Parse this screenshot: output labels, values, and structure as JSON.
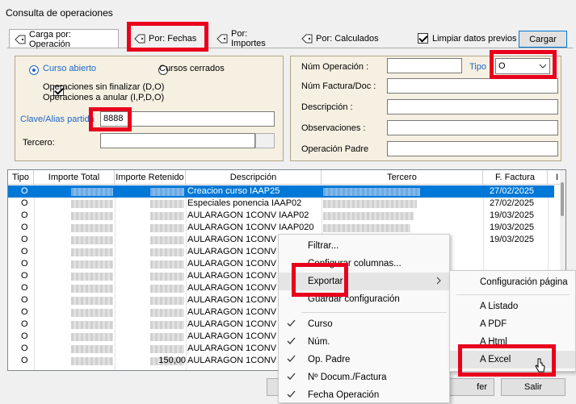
{
  "window": {
    "title": "Consulta de operaciones"
  },
  "tabs": [
    {
      "label": "Carga por: Operación",
      "icon": "tag-icon"
    },
    {
      "label": "Por: Fechas",
      "icon": "tag-icon"
    },
    {
      "label": "Por: Importes",
      "icon": "tag-icon"
    },
    {
      "label": "Por: Calculados",
      "icon": "tag-icon"
    }
  ],
  "toolbar": {
    "clear_label": "Limpiar datos previos",
    "clear_checked": true,
    "load_label": "Cargar"
  },
  "left_panel": {
    "radio_open": "Curso abierto",
    "radio_closed": "Cursos cerrados",
    "chk_line1": "Operaciones sin finalizar (D,O)",
    "chk_line2": "Operaciones a anular (I,P,D,O)",
    "key_label": "Clave/Alias partida",
    "key_value": "8888",
    "third_label": "Tercero:",
    "third_value": ""
  },
  "right_panel": {
    "num_op_label": "Núm Operación :",
    "num_op_value": "",
    "tipo_label": "Tipo",
    "tipo_value": "O",
    "num_fact_label": "Núm Factura/Doc :",
    "desc_label": "Descripción :",
    "obs_label": "Observaciones :",
    "parent_label": "Operación Padre"
  },
  "grid": {
    "headers": [
      "Tipo",
      "Importe Total",
      "Importe Retenido",
      "Descripción",
      "Tercero",
      "F. Factura",
      "I"
    ],
    "rows": [
      {
        "tipo": "O",
        "desc": "Creacion curso IAAP25",
        "fecha": "27/02/2025"
      },
      {
        "tipo": "O",
        "desc": "Especiales ponencia IAAP02",
        "fecha": "27/02/2025"
      },
      {
        "tipo": "O",
        "desc": "AULARAGON 1CONV IAAP02",
        "fecha": "19/03/2025"
      },
      {
        "tipo": "O",
        "desc": "AULARAGON 1CONV IAAP020",
        "fecha": "19/03/2025"
      },
      {
        "tipo": "O",
        "desc": "AULARAGON 1CONV",
        "fecha": "19/03/2025"
      },
      {
        "tipo": "O",
        "desc": "AULARAGON 1CONV",
        "fecha": ""
      },
      {
        "tipo": "O",
        "desc": "AULARAGON 1CONV",
        "fecha": ""
      },
      {
        "tipo": "O",
        "desc": "AULARAGON 1CONV",
        "fecha": ""
      },
      {
        "tipo": "O",
        "desc": "AULARAGON 1CONV",
        "fecha": ""
      },
      {
        "tipo": "O",
        "desc": "AULARAGON 1CONV",
        "fecha": ""
      },
      {
        "tipo": "O",
        "desc": "AULARAGON 1CONV",
        "fecha": ""
      },
      {
        "tipo": "O",
        "desc": "AULARAGON 1CONV",
        "fecha": ""
      },
      {
        "tipo": "O",
        "desc": "AULARAGON 1CONV",
        "fecha": ""
      },
      {
        "tipo": "O",
        "desc": "AULARAGON 1CONV",
        "fecha": ""
      },
      {
        "tipo": "O",
        "desc": "AULARAGON 1CONV",
        "fecha": ""
      }
    ],
    "retenido_partial": "150,00"
  },
  "bottom_buttons": {
    "partial_label": "fer",
    "exit_label": "Salir"
  },
  "context_menu": {
    "items": [
      "Filtrar...",
      "Configurar columnas...",
      "Exportar",
      "Guardar configuración"
    ],
    "checked_items": [
      "Curso",
      "Núm.",
      "Op. Padre",
      "Nº Docum./Factura",
      "Fecha Operación"
    ]
  },
  "submenu": {
    "items": [
      "Configuración página",
      "A Listado",
      "A PDF",
      "A Html",
      "A Excel"
    ]
  },
  "colors": {
    "highlight": "#e8001c",
    "selection": "#0078d7",
    "panel": "#f6f0e2"
  }
}
